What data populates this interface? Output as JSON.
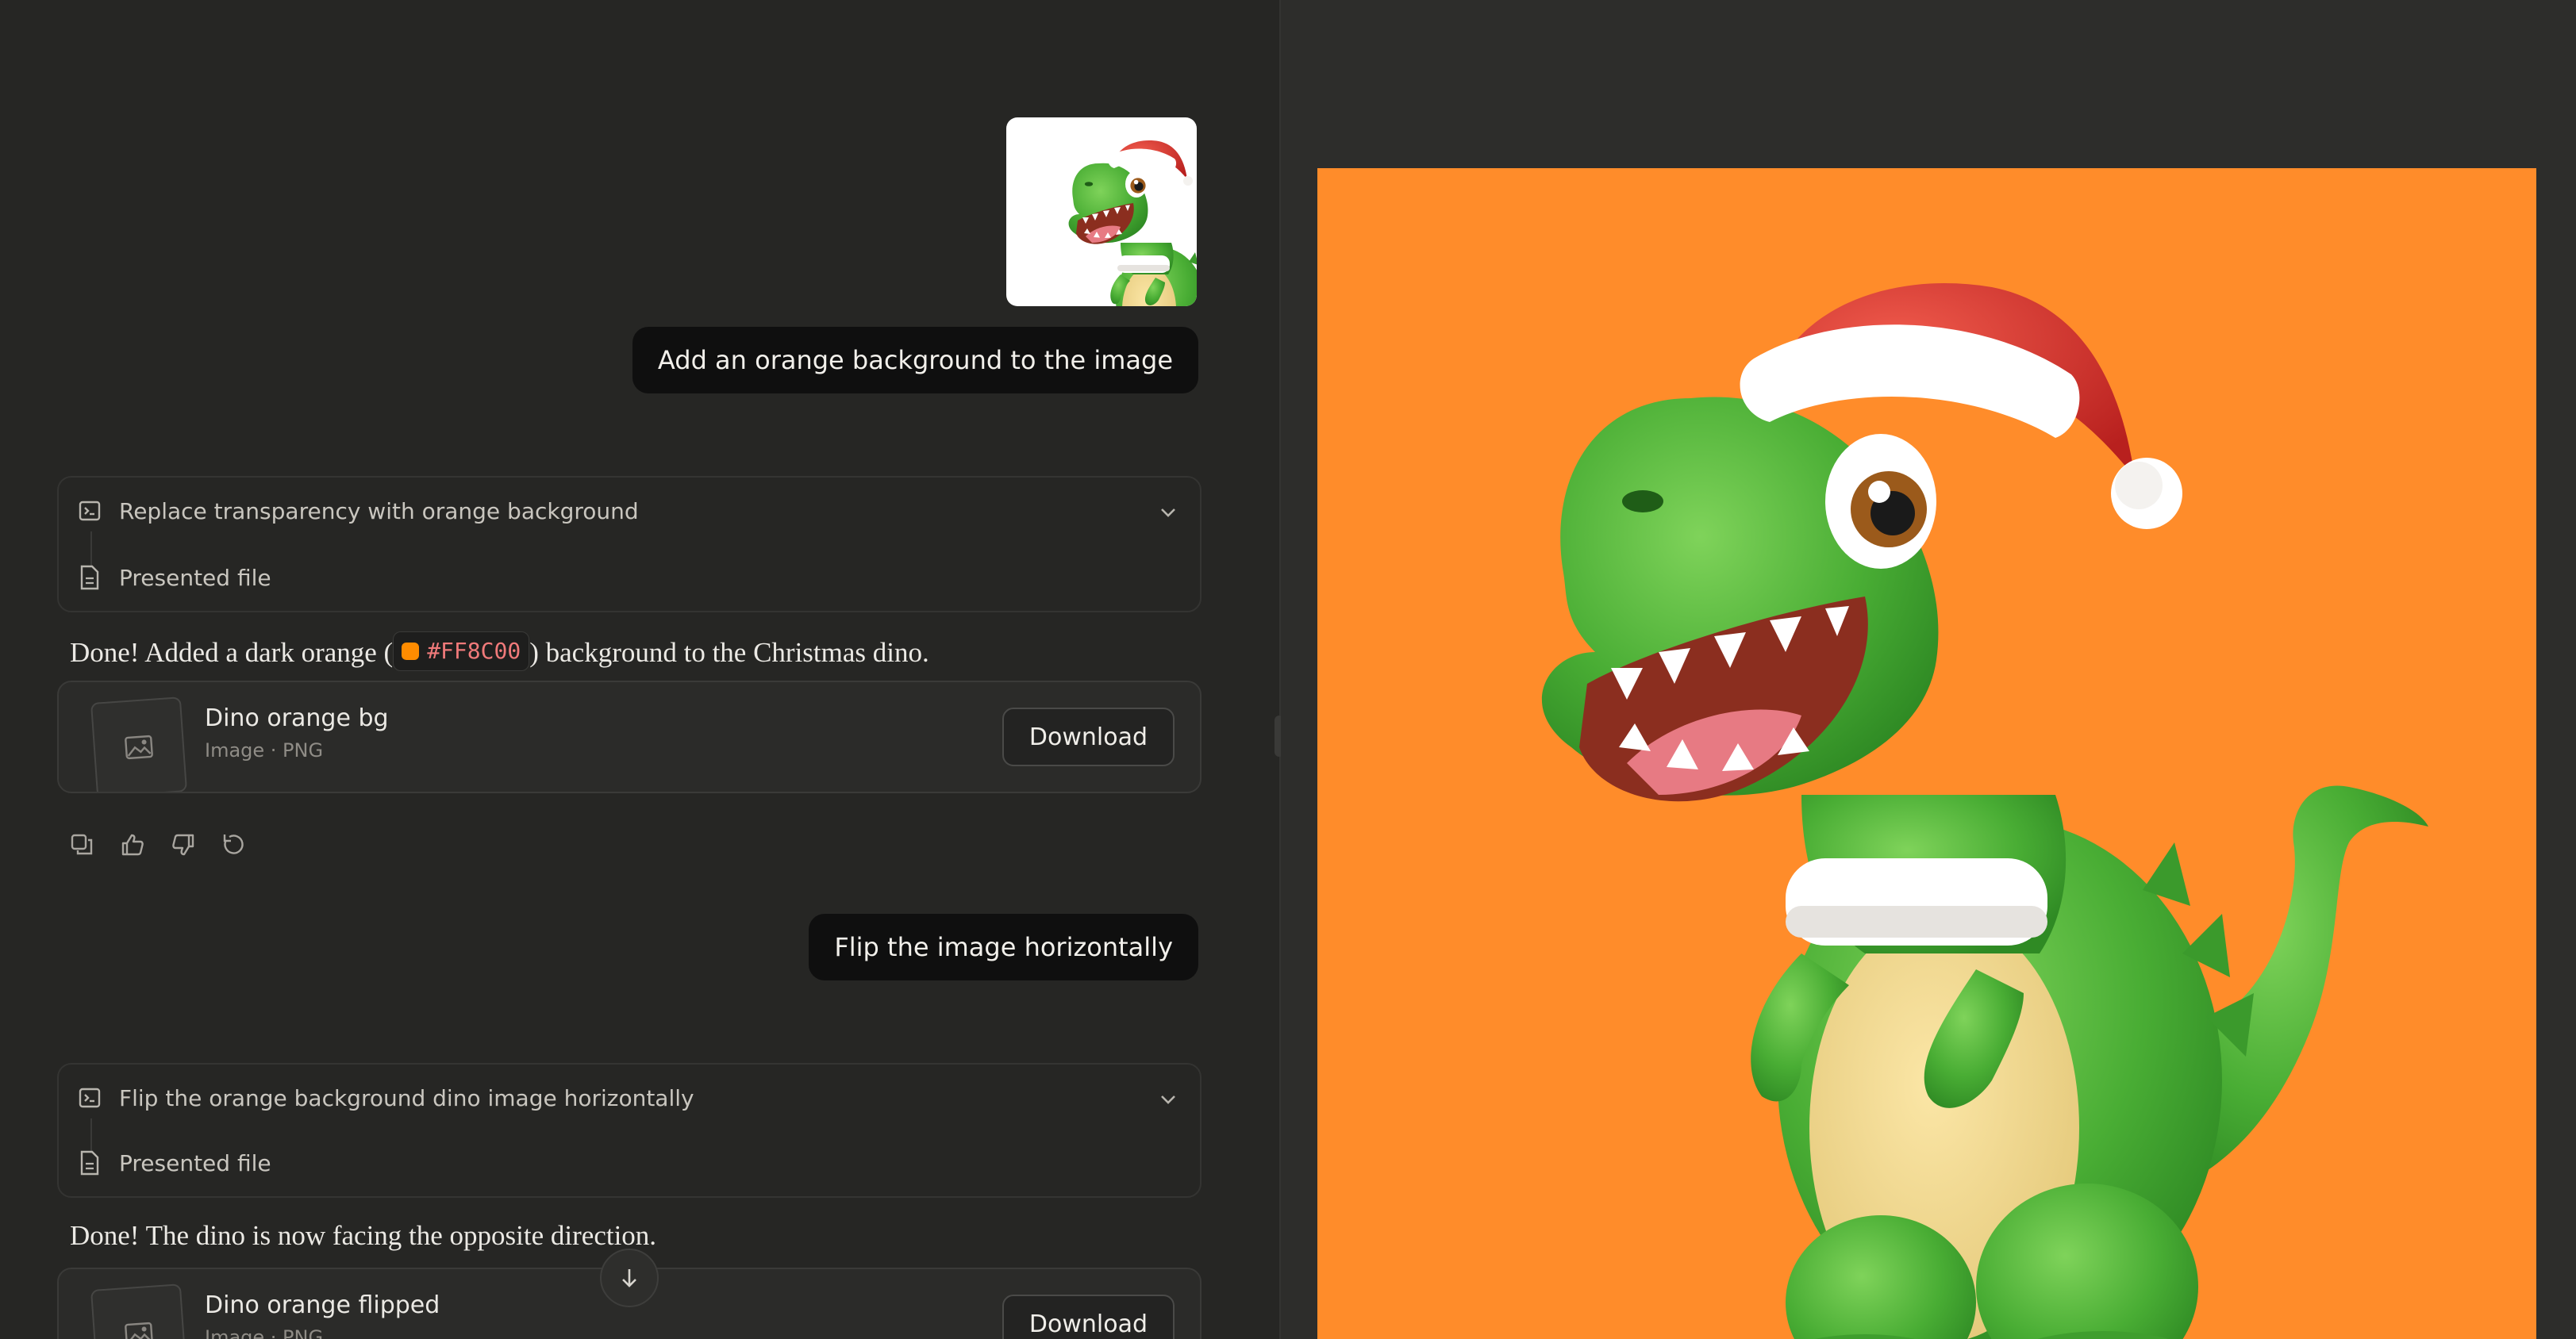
{
  "conversation": {
    "message1": {
      "text": "Add an orange background to the image"
    },
    "tool1": {
      "title": "Replace transparency with orange background",
      "result": "Presented file"
    },
    "reply1": {
      "before": "Done! Added a dark orange (",
      "code": "#FF8C00",
      "after": ") background to the Christmas dino.",
      "swatch_color": "#FF8C00"
    },
    "file1": {
      "name": "Dino orange bg",
      "meta": "Image · PNG",
      "download": "Download"
    },
    "message2": {
      "text": "Flip the image horizontally"
    },
    "tool2": {
      "title": "Flip the orange background dino image horizontally",
      "result": "Presented file"
    },
    "reply2": {
      "text": "Done! The dino is now facing the opposite direction."
    },
    "file2": {
      "name": "Dino orange flipped",
      "meta": "Image · PNG",
      "download": "Download"
    }
  },
  "colors": {
    "background_orange": "#FF8C00",
    "chat_bg": "#262624"
  }
}
